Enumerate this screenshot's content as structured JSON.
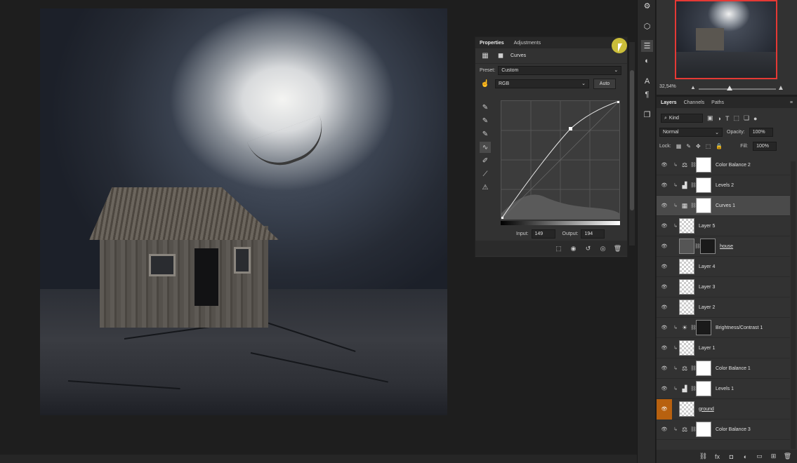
{
  "properties_panel": {
    "tabs": [
      {
        "label": "Properties"
      },
      {
        "label": "Adjustments"
      }
    ],
    "title": "Curves",
    "preset_label": "Preset:",
    "preset_value": "Custom",
    "channel_value": "RGB",
    "auto_label": "Auto",
    "input_label": "Input:",
    "input_value": "149",
    "output_label": "Output:",
    "output_value": "194"
  },
  "navigator": {
    "zoom": "32,54%"
  },
  "layers_panel": {
    "tabs": [
      {
        "label": "Layers"
      },
      {
        "label": "Channels"
      },
      {
        "label": "Paths"
      }
    ],
    "kind_filter": "Kind",
    "blend_mode": "Normal",
    "opacity_label": "Opacity:",
    "opacity_value": "100%",
    "lock_label": "Lock:",
    "fill_label": "Fill:",
    "fill_value": "100%",
    "layers": [
      {
        "name": "Color Balance 2",
        "type": "color-balance",
        "clipped": true,
        "selected": false
      },
      {
        "name": "Levels 2",
        "type": "levels",
        "clipped": true,
        "selected": false
      },
      {
        "name": "Curves 1",
        "type": "curves",
        "clipped": true,
        "selected": true
      },
      {
        "name": "Layer 5",
        "type": "pixel",
        "clipped": true,
        "selected": false
      },
      {
        "name": "house",
        "type": "masked",
        "clipped": false,
        "selected": false
      },
      {
        "name": "Layer 4",
        "type": "pixel",
        "clipped": false,
        "selected": false
      },
      {
        "name": "Layer 3",
        "type": "pixel",
        "clipped": false,
        "selected": false
      },
      {
        "name": "Layer 2",
        "type": "pixel",
        "clipped": false,
        "selected": false
      },
      {
        "name": "Brightness/Contrast 1",
        "type": "brightness-contrast",
        "clipped": true,
        "selected": false
      },
      {
        "name": "Layer 1",
        "type": "pixel",
        "clipped": true,
        "selected": false
      },
      {
        "name": "Color Balance 1",
        "type": "color-balance",
        "clipped": true,
        "selected": false
      },
      {
        "name": "Levels 1",
        "type": "levels",
        "clipped": true,
        "selected": false
      },
      {
        "name": "ground",
        "type": "pixel",
        "clipped": false,
        "selected": false,
        "eye_highlight": true
      },
      {
        "name": "Color Balance 3",
        "type": "color-balance",
        "clipped": true,
        "selected": false
      }
    ]
  },
  "colors": {
    "panel_bg": "#323232",
    "accent_orange": "#b8610f",
    "navigator_border": "#e53935"
  }
}
